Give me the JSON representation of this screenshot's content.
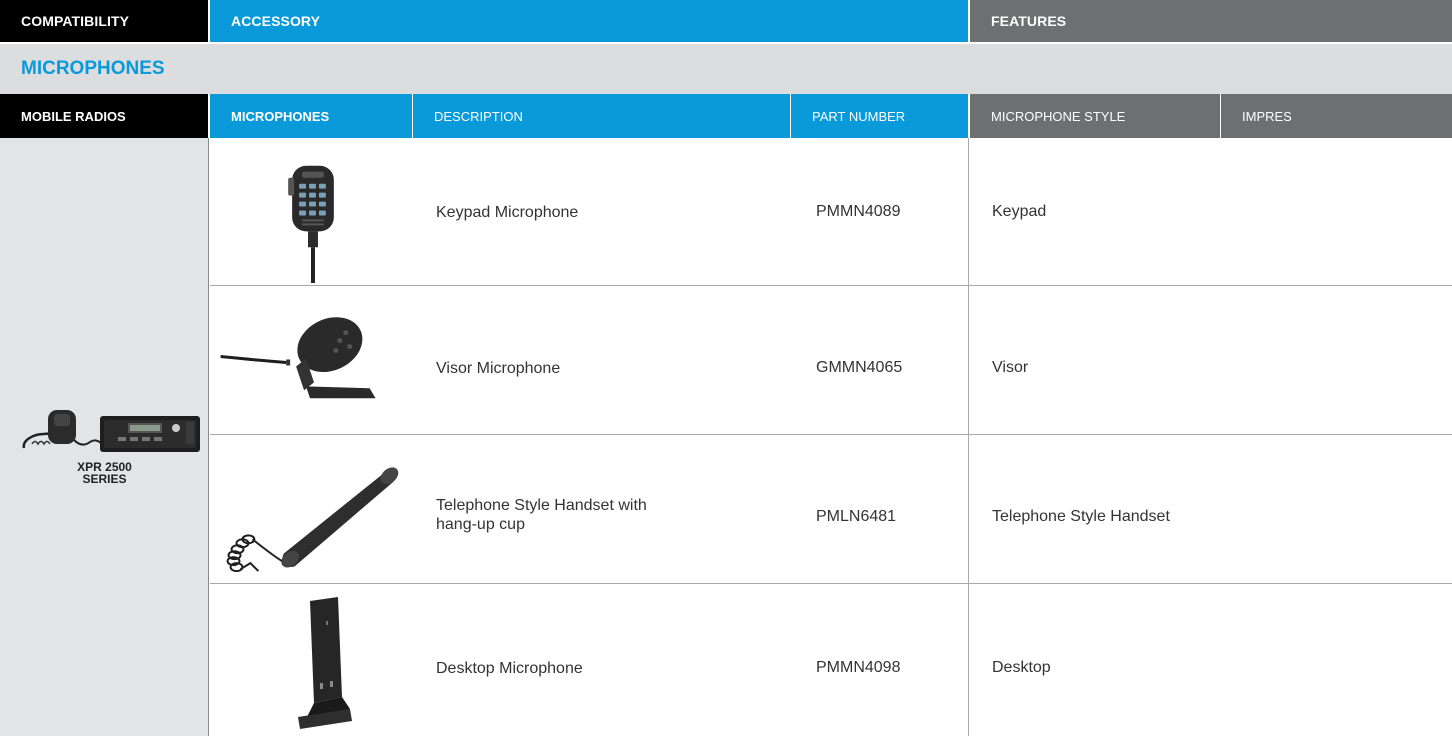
{
  "header": {
    "compatibility": "COMPATIBILITY",
    "accessory": "ACCESSORY",
    "features": "FEATURES"
  },
  "section": {
    "title": "MICROPHONES"
  },
  "columns": {
    "mobile_radios": "MOBILE RADIOS",
    "microphones": "MICROPHONES",
    "description": "DESCRIPTION",
    "part_number": "PART NUMBER",
    "microphone_style": "MICROPHONE STYLE",
    "impres": "IMPRES"
  },
  "compatibility": {
    "line1": "XPR 2500",
    "line2": "SERIES"
  },
  "rows": [
    {
      "description": "Keypad Microphone",
      "part": "PMMN4089",
      "style": "Keypad",
      "impres": ""
    },
    {
      "description": "Visor Microphone",
      "part": "GMMN4065",
      "style": "Visor",
      "impres": ""
    },
    {
      "description_line1": "Telephone Style Handset with",
      "description_line2": "hang-up cup",
      "part": "PMLN6481",
      "style": "Telephone Style Handset",
      "impres": ""
    },
    {
      "description": "Desktop Microphone",
      "part": "PMMN4098",
      "style": "Desktop",
      "impres": ""
    }
  ],
  "colors": {
    "accent_blue": "#0a9ad9",
    "header_black": "#000000",
    "header_gray": "#6e6f71",
    "section_gray": "#dcddde"
  }
}
